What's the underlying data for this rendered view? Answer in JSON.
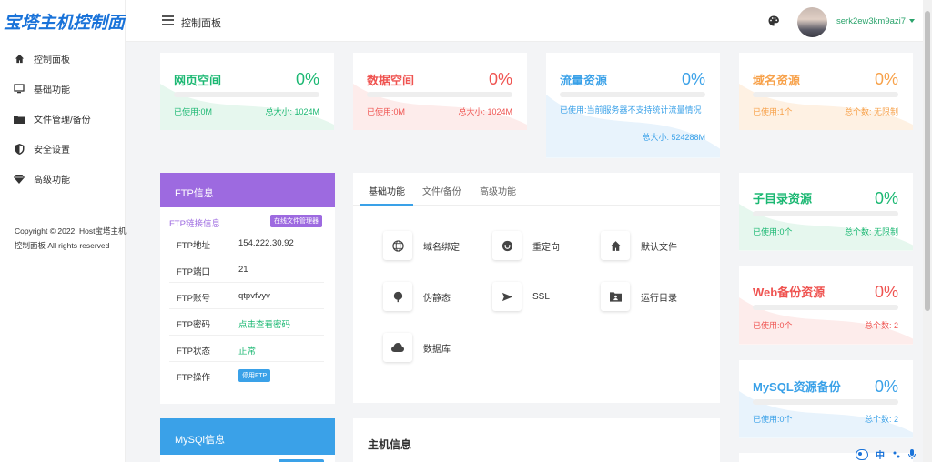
{
  "brand": {
    "logo": "宝塔主机控制面板"
  },
  "sidebar": {
    "items": [
      {
        "label": "控制面板",
        "icon": "home-icon"
      },
      {
        "label": "基础功能",
        "icon": "monitor-icon"
      },
      {
        "label": "文件管理/备份",
        "icon": "folder-icon"
      },
      {
        "label": "安全设置",
        "icon": "shield-icon"
      },
      {
        "label": "高级功能",
        "icon": "diamond-icon"
      }
    ],
    "copyright": "Copyright © 2022. Host宝塔主机控制面板 All rights reserved"
  },
  "header": {
    "title": "控制面板",
    "username": "serk2ew3km9azi7"
  },
  "resources": [
    {
      "name": "网页空间",
      "pct": "0%",
      "used": "已使用:0M",
      "total": "总大小: 1024M",
      "color": "green"
    },
    {
      "name": "数据空间",
      "pct": "0%",
      "used": "已使用:0M",
      "total": "总大小: 1024M",
      "color": "red"
    },
    {
      "name": "流量资源",
      "pct": "0%",
      "used": "已使用:当前服务器不支持统计流量情况",
      "total": "总大小: 524288M",
      "color": "blue"
    },
    {
      "name": "域名资源",
      "pct": "0%",
      "used": "已使用:1个",
      "total": "总个数: 无限制",
      "color": "orange"
    },
    {
      "name": "子目录资源",
      "pct": "0%",
      "used": "已使用:0个",
      "total": "总个数: 无限制",
      "color": "green"
    },
    {
      "name": "Web备份资源",
      "pct": "0%",
      "used": "已使用:0个",
      "total": "总个数: 2",
      "color": "red"
    },
    {
      "name": "MySQL资源备份",
      "pct": "0%",
      "used": "已使用:0个",
      "total": "总个数: 2",
      "color": "blue"
    }
  ],
  "ftp": {
    "title": "FTP信息",
    "subtitle": "FTP链接信息",
    "manager_btn": "在线文件管理器",
    "rows": [
      {
        "k": "FTP地址",
        "v": "154.222.30.92"
      },
      {
        "k": "FTP端口",
        "v": "21"
      },
      {
        "k": "FTP账号",
        "v": "qtpvfvyv"
      },
      {
        "k": "FTP密码",
        "v": "点击查看密码"
      },
      {
        "k": "FTP状态",
        "v": "正常"
      },
      {
        "k": "FTP操作",
        "v": "停用FTP"
      }
    ]
  },
  "features": {
    "tabs": [
      "基础功能",
      "文件/备份",
      "高级功能"
    ],
    "items": [
      {
        "label": "域名绑定",
        "icon": "globe-icon"
      },
      {
        "label": "重定向",
        "icon": "redirect-icon"
      },
      {
        "label": "默认文件",
        "icon": "home-icon"
      },
      {
        "label": "伪静态",
        "icon": "leaf-icon"
      },
      {
        "label": "SSL",
        "icon": "send-icon"
      },
      {
        "label": "运行目录",
        "icon": "folder-user-icon"
      },
      {
        "label": "数据库",
        "icon": "cloud-icon"
      }
    ]
  },
  "mysql": {
    "title": "MySQl信息"
  },
  "host": {
    "title": "主机信息"
  },
  "colors": {
    "green": "#1cb873",
    "red": "#ef5350",
    "blue": "#3aa1e8",
    "orange": "#f7a14a",
    "purple": "#9d6ae0"
  }
}
